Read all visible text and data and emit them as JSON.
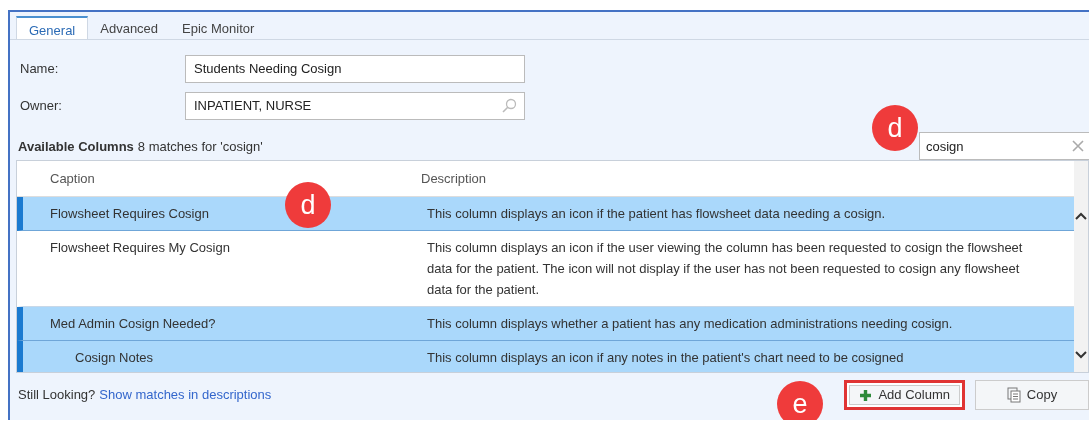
{
  "tabs": [
    {
      "label": "General",
      "selected": true
    },
    {
      "label": "Advanced",
      "selected": false
    },
    {
      "label": "Epic Monitor",
      "selected": false
    }
  ],
  "form": [
    {
      "label": "Name:",
      "value": "Students Needing Cosign",
      "kind": "text"
    },
    {
      "label": "Owner:",
      "value": "INPATIENT, NURSE",
      "kind": "lookup"
    }
  ],
  "available_columns": {
    "title": "Available Columns",
    "match_count": "8 matches for 'cosign'"
  },
  "search": {
    "value": "cosign"
  },
  "table": {
    "columns": [
      "Caption",
      "Description"
    ],
    "rows": [
      {
        "caption": "Flowsheet Requires Cosign",
        "description": "This column displays an icon if the patient has flowsheet data needing a cosign.",
        "selected": true
      },
      {
        "caption": "Flowsheet Requires My Cosign",
        "description": "This column displays an icon if the user viewing the column has been requested to cosign the flowsheet data for the patient. The icon will not display if the user has not been requested to cosign any flowsheet data for the patient.",
        "selected": false
      },
      {
        "caption": "Med Admin Cosign Needed?",
        "description": "This column displays whether a patient has any medication administrations needing cosign.",
        "selected": true,
        "children": [
          {
            "caption": "Cosign Notes",
            "description": "This column displays an icon if any notes in the patient's chart need to be cosigned",
            "selected": true
          }
        ]
      }
    ]
  },
  "footer": {
    "prompt": "Still Looking?",
    "link": "Show matches in descriptions"
  },
  "buttons": [
    {
      "label": "Add Column",
      "kind": "add",
      "highlighted": true
    },
    {
      "label": "Copy",
      "kind": "copy",
      "highlighted": false
    }
  ],
  "callouts": [
    {
      "letter": "d"
    },
    {
      "letter": "d"
    },
    {
      "letter": "e"
    }
  ]
}
